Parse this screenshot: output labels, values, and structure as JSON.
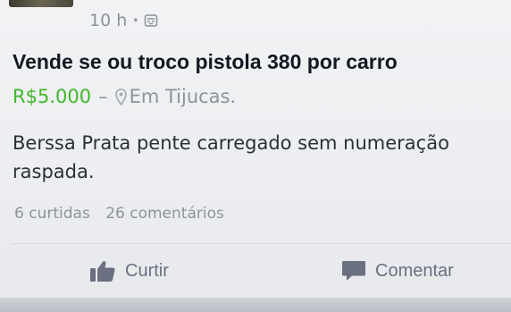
{
  "post": {
    "timestamp": "10 h",
    "separator": "•",
    "privacy_icon": "public-globe-icon",
    "title": "Vende se ou troco pistola 380 por carro",
    "price": "R$5.000",
    "price_separator": "–",
    "location_icon": "map-pin-icon",
    "location": "Em Tijucas.",
    "description_lines": [
      "Berssa Prata pente carregado sem numeração",
      "raspada."
    ]
  },
  "stats": {
    "likes": "6 curtidas",
    "comments": "26 comentários"
  },
  "actions": {
    "like_label": "Curtir",
    "like_icon": "thumbs-up-icon",
    "comment_label": "Comentar",
    "comment_icon": "speech-bubble-icon"
  },
  "colors": {
    "price": "#42b72a",
    "meta": "#8e929a",
    "title": "#141823",
    "action": "#6a7080"
  }
}
